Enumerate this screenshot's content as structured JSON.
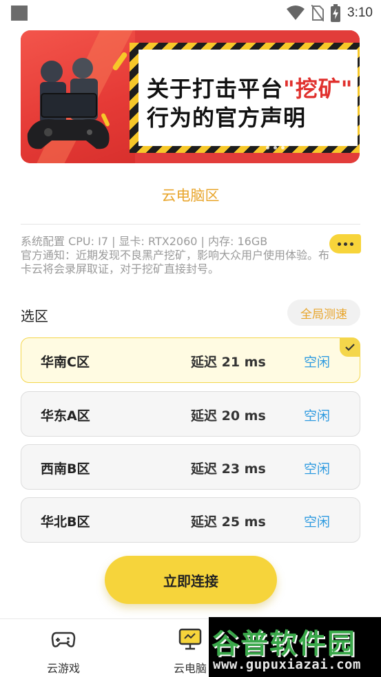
{
  "status_bar": {
    "time": "3:10"
  },
  "banner": {
    "line1_prefix": "关于打击平台",
    "line1_highlight": "\"挖矿\"",
    "line2": "行为的官方声明"
  },
  "section_title": "云电脑区",
  "system_info": "系统配置 CPU: I7 | 显卡: RTX2060 | 内存: 16GB",
  "notice": "官方通知：近期发现不良黑产挖矿，影响大众用户使用体验。布卡云将会录屏取证，对于挖矿直接封号。",
  "region_header": {
    "label": "选区",
    "speedtest_label": "全局测速"
  },
  "regions": [
    {
      "name": "华南C区",
      "latency": "延迟  21 ms",
      "status": "空闲",
      "selected": true
    },
    {
      "name": "华东A区",
      "latency": "延迟  20 ms",
      "status": "空闲",
      "selected": false
    },
    {
      "name": "西南B区",
      "latency": "延迟  23 ms",
      "status": "空闲",
      "selected": false
    },
    {
      "name": "华北B区",
      "latency": "延迟  25 ms",
      "status": "空闲",
      "selected": false
    }
  ],
  "connect_label": "立即连接",
  "tabs": [
    {
      "label": "云游戏",
      "icon": "gamepad-icon"
    },
    {
      "label": "云电脑",
      "icon": "monitor-icon"
    }
  ],
  "watermark": {
    "title": "谷普软件园",
    "url": "www.gupuxiazai.com"
  },
  "colors": {
    "accent_yellow": "#f6d43b",
    "accent_orange": "#e8a52b",
    "status_blue": "#2f9be0",
    "banner_red": "#e23c3a"
  }
}
